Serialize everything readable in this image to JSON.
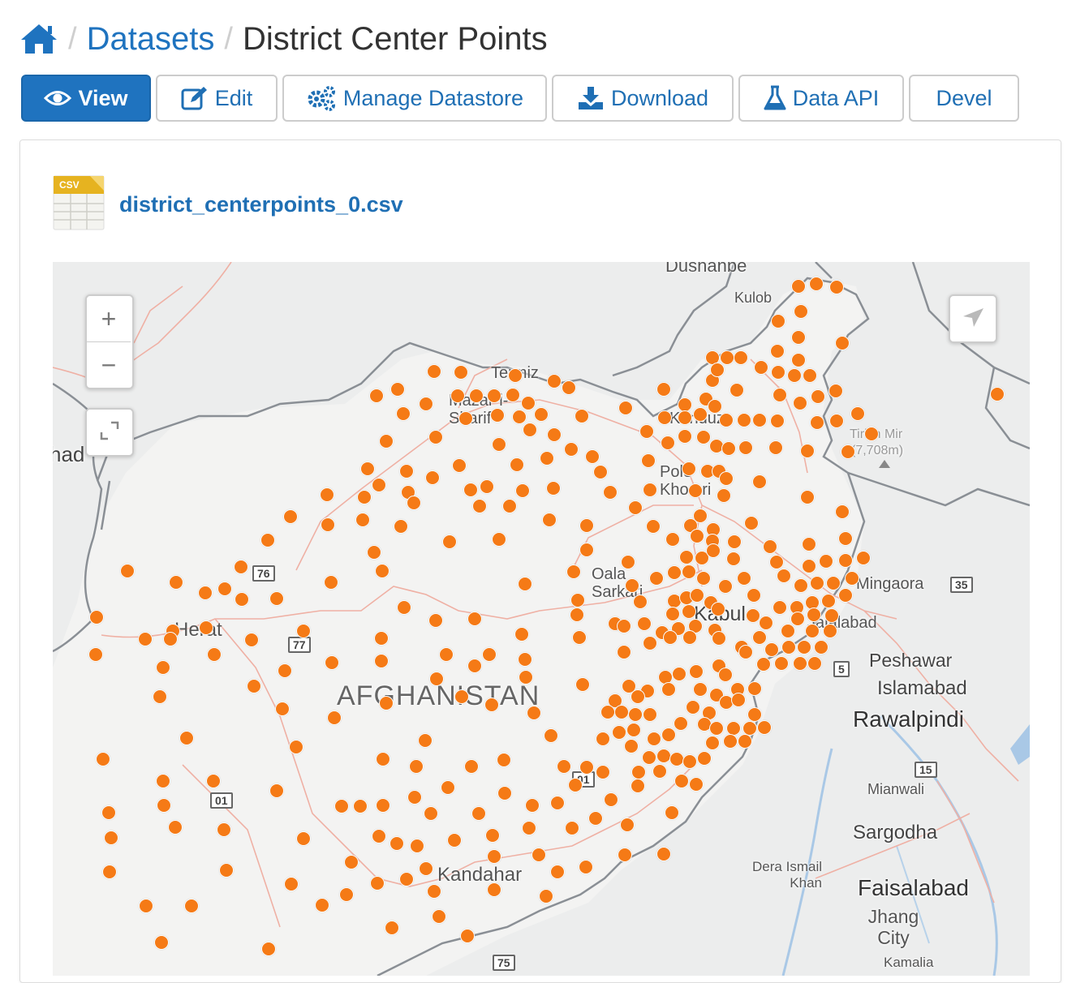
{
  "breadcrumb": {
    "home_icon": "home-icon",
    "datasets": "Datasets",
    "current": "District Center Points"
  },
  "toolbar": {
    "view": "View",
    "edit": "Edit",
    "manage": "Manage Datastore",
    "download": "Download",
    "api": "Data API",
    "devel": "Devel"
  },
  "resource": {
    "file_name": "district_centerpoints_0.csv",
    "icon": "csv-file-icon",
    "icon_badge": "CSV"
  },
  "map": {
    "marker_color": "#f57a16",
    "zoom_in": "+",
    "zoom_out": "−",
    "labels": {
      "dushanbe": "Dushanbe",
      "kulob": "Kulob",
      "termiz": "Termiz",
      "mazar": "Mazar-i-Sharif",
      "kunduz": "Kunduz",
      "pole": "Pole Khomri",
      "tirich": "Tirich Mir",
      "tirich_elev": "(7,708m)",
      "herat": "Herat",
      "afghanistan": "AFGHANISTAN",
      "oala": "Oala Sarkari",
      "kabul": "Kabul",
      "jalalabad": "Jalalabad",
      "mingaora": "Mingaora",
      "peshawar": "Peshawar",
      "islamabad": "Islamabad",
      "rawalpindi": "Rawalpindi",
      "mianwali": "Mianwali",
      "sargodha": "Sargodha",
      "kandahar": "Kandahar",
      "dera": "Dera Ismail Khan",
      "faisalabad": "Faisalabad",
      "jhang": "Jhang City",
      "kamalia": "Kamalia",
      "mashhad_frag": "had"
    },
    "shields": [
      "76",
      "77",
      "01",
      "01",
      "75",
      "5",
      "35",
      "15"
    ],
    "points": [
      [
        983,
        352
      ],
      [
        1005,
        349
      ],
      [
        1030,
        353
      ],
      [
        986,
        383
      ],
      [
        958,
        395
      ],
      [
        983,
        415
      ],
      [
        1037,
        422
      ],
      [
        957,
        432
      ],
      [
        983,
        443
      ],
      [
        877,
        440
      ],
      [
        895,
        440
      ],
      [
        912,
        440
      ],
      [
        937,
        452
      ],
      [
        877,
        468
      ],
      [
        883,
        455
      ],
      [
        958,
        458
      ],
      [
        978,
        462
      ],
      [
        997,
        462
      ],
      [
        907,
        480
      ],
      [
        1029,
        481
      ],
      [
        960,
        486
      ],
      [
        985,
        496
      ],
      [
        1007,
        488
      ],
      [
        534,
        457
      ],
      [
        567,
        458
      ],
      [
        634,
        462
      ],
      [
        682,
        469
      ],
      [
        700,
        477
      ],
      [
        489,
        479
      ],
      [
        463,
        487
      ],
      [
        524,
        497
      ],
      [
        563,
        487
      ],
      [
        586,
        487
      ],
      [
        608,
        487
      ],
      [
        631,
        486
      ],
      [
        650,
        496
      ],
      [
        716,
        512
      ],
      [
        770,
        502
      ],
      [
        817,
        479
      ],
      [
        843,
        498
      ],
      [
        869,
        491
      ],
      [
        880,
        500
      ],
      [
        862,
        510
      ],
      [
        818,
        514
      ],
      [
        843,
        514
      ],
      [
        894,
        517
      ],
      [
        916,
        517
      ],
      [
        935,
        517
      ],
      [
        957,
        518
      ],
      [
        1006,
        520
      ],
      [
        1030,
        518
      ],
      [
        1056,
        509
      ],
      [
        1228,
        485
      ],
      [
        496,
        509
      ],
      [
        573,
        515
      ],
      [
        612,
        511
      ],
      [
        639,
        513
      ],
      [
        666,
        510
      ],
      [
        652,
        529
      ],
      [
        682,
        535
      ],
      [
        475,
        543
      ],
      [
        536,
        538
      ],
      [
        614,
        547
      ],
      [
        703,
        553
      ],
      [
        729,
        562
      ],
      [
        673,
        564
      ],
      [
        796,
        531
      ],
      [
        822,
        545
      ],
      [
        843,
        537
      ],
      [
        866,
        538
      ],
      [
        882,
        549
      ],
      [
        897,
        552
      ],
      [
        918,
        551
      ],
      [
        955,
        551
      ],
      [
        994,
        555
      ],
      [
        1044,
        556
      ],
      [
        1073,
        534
      ],
      [
        565,
        573
      ],
      [
        636,
        572
      ],
      [
        452,
        577
      ],
      [
        500,
        580
      ],
      [
        532,
        588
      ],
      [
        739,
        581
      ],
      [
        798,
        567
      ],
      [
        848,
        577
      ],
      [
        871,
        580
      ],
      [
        885,
        580
      ],
      [
        894,
        589
      ],
      [
        935,
        593
      ],
      [
        466,
        597
      ],
      [
        502,
        606
      ],
      [
        579,
        603
      ],
      [
        599,
        599
      ],
      [
        643,
        604
      ],
      [
        681,
        601
      ],
      [
        751,
        606
      ],
      [
        800,
        603
      ],
      [
        856,
        604
      ],
      [
        891,
        610
      ],
      [
        994,
        612
      ],
      [
        448,
        612
      ],
      [
        402,
        609
      ],
      [
        509,
        619
      ],
      [
        590,
        623
      ],
      [
        627,
        623
      ],
      [
        782,
        625
      ],
      [
        862,
        635
      ],
      [
        925,
        644
      ],
      [
        1037,
        630
      ],
      [
        357,
        636
      ],
      [
        403,
        646
      ],
      [
        446,
        640
      ],
      [
        493,
        648
      ],
      [
        676,
        640
      ],
      [
        722,
        647
      ],
      [
        804,
        648
      ],
      [
        850,
        647
      ],
      [
        878,
        652
      ],
      [
        329,
        665
      ],
      [
        553,
        667
      ],
      [
        614,
        664
      ],
      [
        722,
        677
      ],
      [
        828,
        664
      ],
      [
        858,
        660
      ],
      [
        877,
        666
      ],
      [
        904,
        667
      ],
      [
        948,
        673
      ],
      [
        996,
        670
      ],
      [
        1041,
        663
      ],
      [
        460,
        680
      ],
      [
        296,
        698
      ],
      [
        156,
        703
      ],
      [
        216,
        717
      ],
      [
        252,
        730
      ],
      [
        276,
        725
      ],
      [
        407,
        717
      ],
      [
        470,
        703
      ],
      [
        706,
        704
      ],
      [
        773,
        692
      ],
      [
        845,
        686
      ],
      [
        864,
        687
      ],
      [
        878,
        678
      ],
      [
        903,
        688
      ],
      [
        956,
        692
      ],
      [
        996,
        697
      ],
      [
        1017,
        691
      ],
      [
        1041,
        690
      ],
      [
        1063,
        687
      ],
      [
        646,
        719
      ],
      [
        778,
        721
      ],
      [
        808,
        712
      ],
      [
        830,
        705
      ],
      [
        848,
        704
      ],
      [
        866,
        712
      ],
      [
        893,
        722
      ],
      [
        916,
        712
      ],
      [
        965,
        709
      ],
      [
        986,
        721
      ],
      [
        1006,
        718
      ],
      [
        1026,
        718
      ],
      [
        1049,
        712
      ],
      [
        297,
        738
      ],
      [
        340,
        737
      ],
      [
        497,
        748
      ],
      [
        711,
        739
      ],
      [
        788,
        741
      ],
      [
        830,
        740
      ],
      [
        845,
        736
      ],
      [
        858,
        733
      ],
      [
        875,
        742
      ],
      [
        928,
        733
      ],
      [
        960,
        748
      ],
      [
        981,
        748
      ],
      [
        1000,
        742
      ],
      [
        1020,
        740
      ],
      [
        1041,
        733
      ],
      [
        118,
        760
      ],
      [
        536,
        764
      ],
      [
        584,
        762
      ],
      [
        710,
        757
      ],
      [
        757,
        768
      ],
      [
        793,
        768
      ],
      [
        828,
        756
      ],
      [
        848,
        753
      ],
      [
        884,
        750
      ],
      [
        927,
        758
      ],
      [
        943,
        767
      ],
      [
        982,
        762
      ],
      [
        1002,
        757
      ],
      [
        1024,
        758
      ],
      [
        212,
        777
      ],
      [
        253,
        773
      ],
      [
        373,
        777
      ],
      [
        178,
        787
      ],
      [
        209,
        787
      ],
      [
        309,
        788
      ],
      [
        469,
        786
      ],
      [
        642,
        781
      ],
      [
        713,
        785
      ],
      [
        768,
        771
      ],
      [
        815,
        779
      ],
      [
        835,
        774
      ],
      [
        856,
        771
      ],
      [
        880,
        776
      ],
      [
        970,
        777
      ],
      [
        1000,
        777
      ],
      [
        1022,
        777
      ],
      [
        117,
        806
      ],
      [
        263,
        806
      ],
      [
        408,
        816
      ],
      [
        469,
        814
      ],
      [
        549,
        806
      ],
      [
        602,
        806
      ],
      [
        646,
        812
      ],
      [
        768,
        803
      ],
      [
        800,
        792
      ],
      [
        825,
        785
      ],
      [
        849,
        785
      ],
      [
        885,
        786
      ],
      [
        913,
        797
      ],
      [
        935,
        785
      ],
      [
        950,
        800
      ],
      [
        971,
        797
      ],
      [
        990,
        797
      ],
      [
        1011,
        797
      ],
      [
        200,
        822
      ],
      [
        350,
        826
      ],
      [
        584,
        820
      ],
      [
        647,
        834
      ],
      [
        885,
        820
      ],
      [
        918,
        803
      ],
      [
        940,
        818
      ],
      [
        962,
        817
      ],
      [
        985,
        817
      ],
      [
        1003,
        817
      ],
      [
        312,
        845
      ],
      [
        537,
        836
      ],
      [
        717,
        843
      ],
      [
        774,
        845
      ],
      [
        797,
        851
      ],
      [
        819,
        834
      ],
      [
        836,
        830
      ],
      [
        857,
        827
      ],
      [
        893,
        831
      ],
      [
        196,
        858
      ],
      [
        475,
        866
      ],
      [
        568,
        858
      ],
      [
        605,
        868
      ],
      [
        757,
        863
      ],
      [
        785,
        858
      ],
      [
        823,
        849
      ],
      [
        862,
        849
      ],
      [
        882,
        856
      ],
      [
        908,
        849
      ],
      [
        929,
        848
      ],
      [
        347,
        873
      ],
      [
        411,
        884
      ],
      [
        657,
        878
      ],
      [
        748,
        877
      ],
      [
        765,
        877
      ],
      [
        782,
        880
      ],
      [
        800,
        880
      ],
      [
        853,
        871
      ],
      [
        873,
        878
      ],
      [
        894,
        865
      ],
      [
        909,
        862
      ],
      [
        929,
        880
      ],
      [
        229,
        909
      ],
      [
        364,
        920
      ],
      [
        523,
        912
      ],
      [
        678,
        906
      ],
      [
        742,
        910
      ],
      [
        762,
        902
      ],
      [
        780,
        899
      ],
      [
        805,
        910
      ],
      [
        823,
        905
      ],
      [
        838,
        891
      ],
      [
        867,
        892
      ],
      [
        882,
        897
      ],
      [
        903,
        897
      ],
      [
        923,
        897
      ],
      [
        941,
        896
      ],
      [
        126,
        935
      ],
      [
        471,
        935
      ],
      [
        512,
        944
      ],
      [
        580,
        944
      ],
      [
        620,
        936
      ],
      [
        694,
        944
      ],
      [
        722,
        945
      ],
      [
        742,
        951
      ],
      [
        777,
        919
      ],
      [
        799,
        933
      ],
      [
        817,
        931
      ],
      [
        833,
        935
      ],
      [
        849,
        938
      ],
      [
        867,
        934
      ],
      [
        877,
        915
      ],
      [
        899,
        913
      ],
      [
        917,
        913
      ],
      [
        200,
        962
      ],
      [
        262,
        962
      ],
      [
        340,
        974
      ],
      [
        551,
        970
      ],
      [
        621,
        977
      ],
      [
        708,
        967
      ],
      [
        785,
        968
      ],
      [
        786,
        951
      ],
      [
        812,
        950
      ],
      [
        839,
        962
      ],
      [
        857,
        966
      ],
      [
        201,
        992
      ],
      [
        420,
        993
      ],
      [
        443,
        993
      ],
      [
        471,
        992
      ],
      [
        510,
        982
      ],
      [
        530,
        1002
      ],
      [
        589,
        1002
      ],
      [
        655,
        992
      ],
      [
        686,
        989
      ],
      [
        752,
        985
      ],
      [
        133,
        1001
      ],
      [
        215,
        1019
      ],
      [
        275,
        1022
      ],
      [
        466,
        1030
      ],
      [
        488,
        1039
      ],
      [
        513,
        1042
      ],
      [
        559,
        1035
      ],
      [
        606,
        1029
      ],
      [
        651,
        1020
      ],
      [
        704,
        1020
      ],
      [
        733,
        1008
      ],
      [
        772,
        1016
      ],
      [
        827,
        1001
      ],
      [
        136,
        1032
      ],
      [
        373,
        1033
      ],
      [
        608,
        1055
      ],
      [
        663,
        1053
      ],
      [
        432,
        1062
      ],
      [
        524,
        1070
      ],
      [
        769,
        1053
      ],
      [
        817,
        1052
      ],
      [
        134,
        1074
      ],
      [
        278,
        1072
      ],
      [
        500,
        1083
      ],
      [
        686,
        1074
      ],
      [
        721,
        1068
      ],
      [
        358,
        1089
      ],
      [
        464,
        1088
      ],
      [
        426,
        1102
      ],
      [
        534,
        1098
      ],
      [
        608,
        1096
      ],
      [
        179,
        1116
      ],
      [
        235,
        1116
      ],
      [
        396,
        1115
      ],
      [
        672,
        1104
      ],
      [
        540,
        1129
      ],
      [
        198,
        1161
      ],
      [
        330,
        1169
      ],
      [
        482,
        1143
      ],
      [
        575,
        1153
      ]
    ]
  }
}
